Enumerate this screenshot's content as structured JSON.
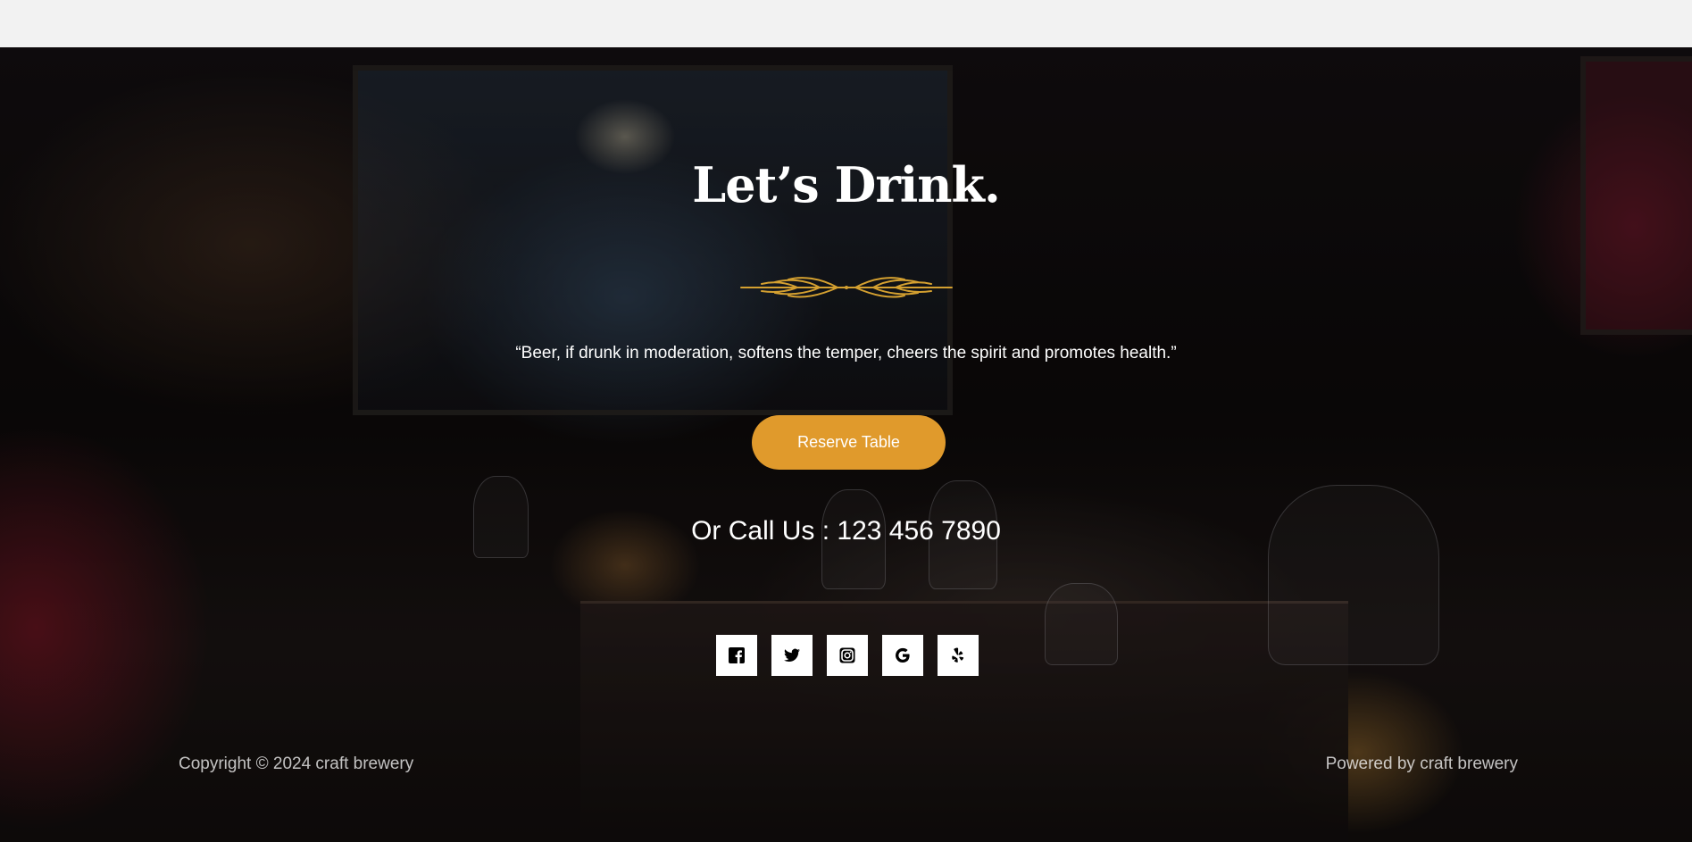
{
  "hero": {
    "title": "Let’s Drink.",
    "quote": "“Beer, if drunk in moderation, softens the temper, cheers the spirit and promotes health.”",
    "reserve_label": "Reserve Table",
    "call_text": "Or Call Us : 123 456 7890"
  },
  "socials": [
    {
      "icon": "facebook-icon"
    },
    {
      "icon": "twitter-icon"
    },
    {
      "icon": "instagram-icon"
    },
    {
      "icon": "google-icon"
    },
    {
      "icon": "yelp-icon"
    }
  ],
  "footer": {
    "copyright": "Copyright © 2024 craft brewery",
    "powered": "Powered by craft brewery"
  },
  "colors": {
    "accent": "#e09a2c",
    "divider_gold": "#d4a030",
    "text": "#ffffff",
    "topbar": "#f2f2f2"
  }
}
